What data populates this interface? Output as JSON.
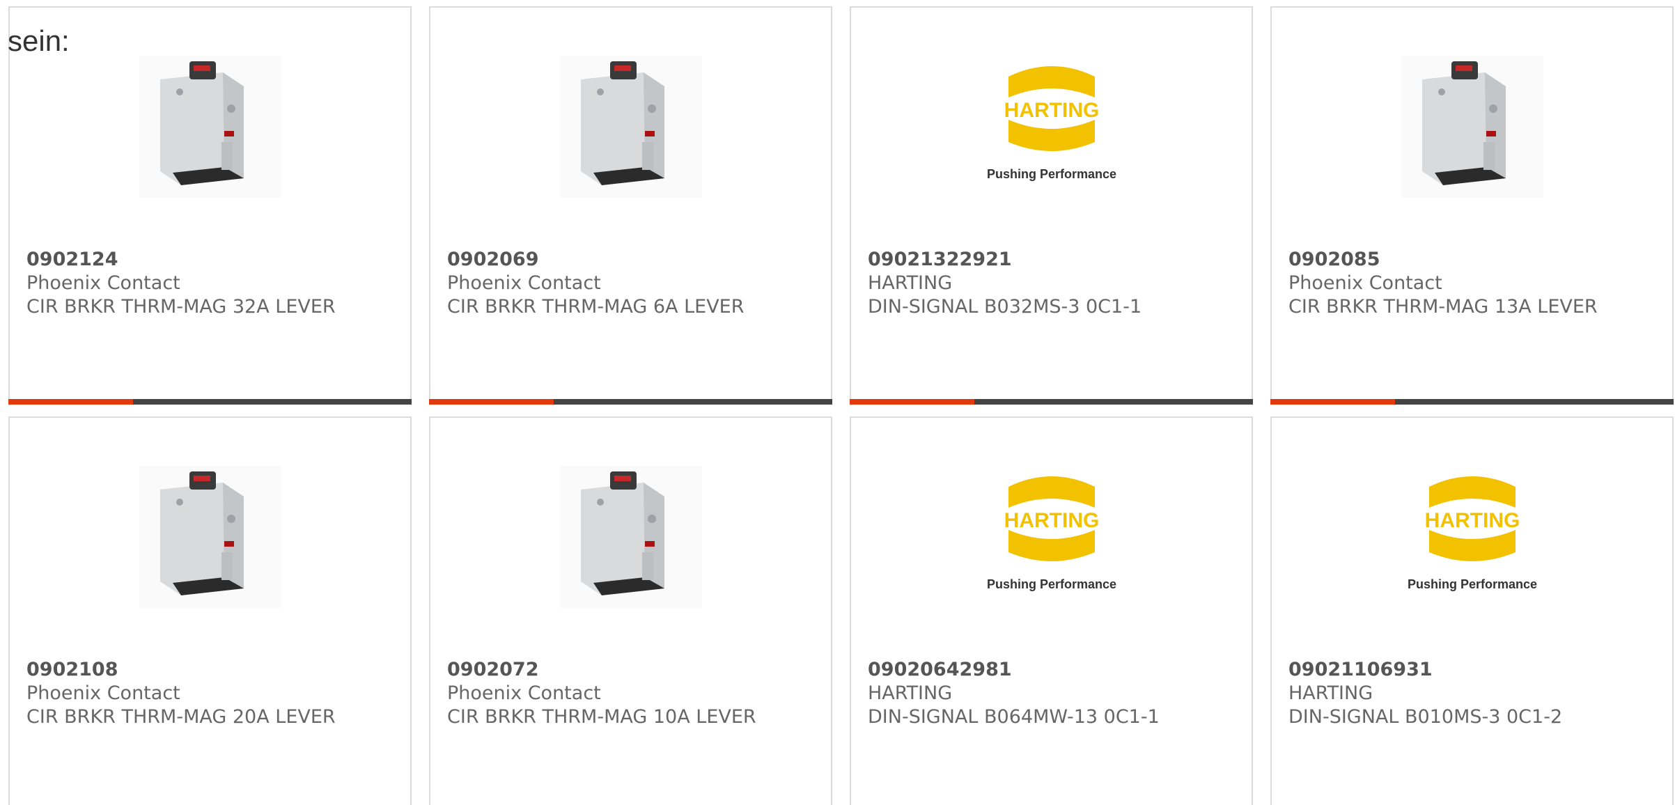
{
  "page": {
    "heading_fragment": "sein:"
  },
  "colors": {
    "card_border": "#dcdcdc",
    "progress_accent": "#e2390f",
    "progress_track": "#444444",
    "text": "#666666",
    "harting_yellow": "#f2c200"
  },
  "products": [
    {
      "part_number": "0902124",
      "manufacturer": "Phoenix Contact",
      "description": "CIR BRKR THRM-MAG 32A LEVER",
      "image": "circuit-breaker-icon",
      "progress": 0.31
    },
    {
      "part_number": "0902069",
      "manufacturer": "Phoenix Contact",
      "description": "CIR BRKR THRM-MAG 6A LEVER",
      "image": "circuit-breaker-icon",
      "progress": 0.31
    },
    {
      "part_number": "09021322921",
      "manufacturer": "HARTING",
      "description": "DIN-SIGNAL B032MS-3 0C1-1",
      "image": "harting-logo",
      "logo_text": "HARTING",
      "logo_tagline": "Pushing Performance",
      "progress": 0.31
    },
    {
      "part_number": "0902085",
      "manufacturer": "Phoenix Contact",
      "description": "CIR BRKR THRM-MAG 13A LEVER",
      "image": "circuit-breaker-icon",
      "progress": 0.31
    },
    {
      "part_number": "0902108",
      "manufacturer": "Phoenix Contact",
      "description": "CIR BRKR THRM-MAG 20A LEVER",
      "image": "circuit-breaker-icon"
    },
    {
      "part_number": "0902072",
      "manufacturer": "Phoenix Contact",
      "description": "CIR BRKR THRM-MAG 10A LEVER",
      "image": "circuit-breaker-icon"
    },
    {
      "part_number": "09020642981",
      "manufacturer": "HARTING",
      "description": "DIN-SIGNAL B064MW-13 0C1-1",
      "image": "harting-logo",
      "logo_text": "HARTING",
      "logo_tagline": "Pushing Performance"
    },
    {
      "part_number": "09021106931",
      "manufacturer": "HARTING",
      "description": "DIN-SIGNAL B010MS-3 0C1-2",
      "image": "harting-logo",
      "logo_text": "HARTING",
      "logo_tagline": "Pushing Performance"
    }
  ]
}
